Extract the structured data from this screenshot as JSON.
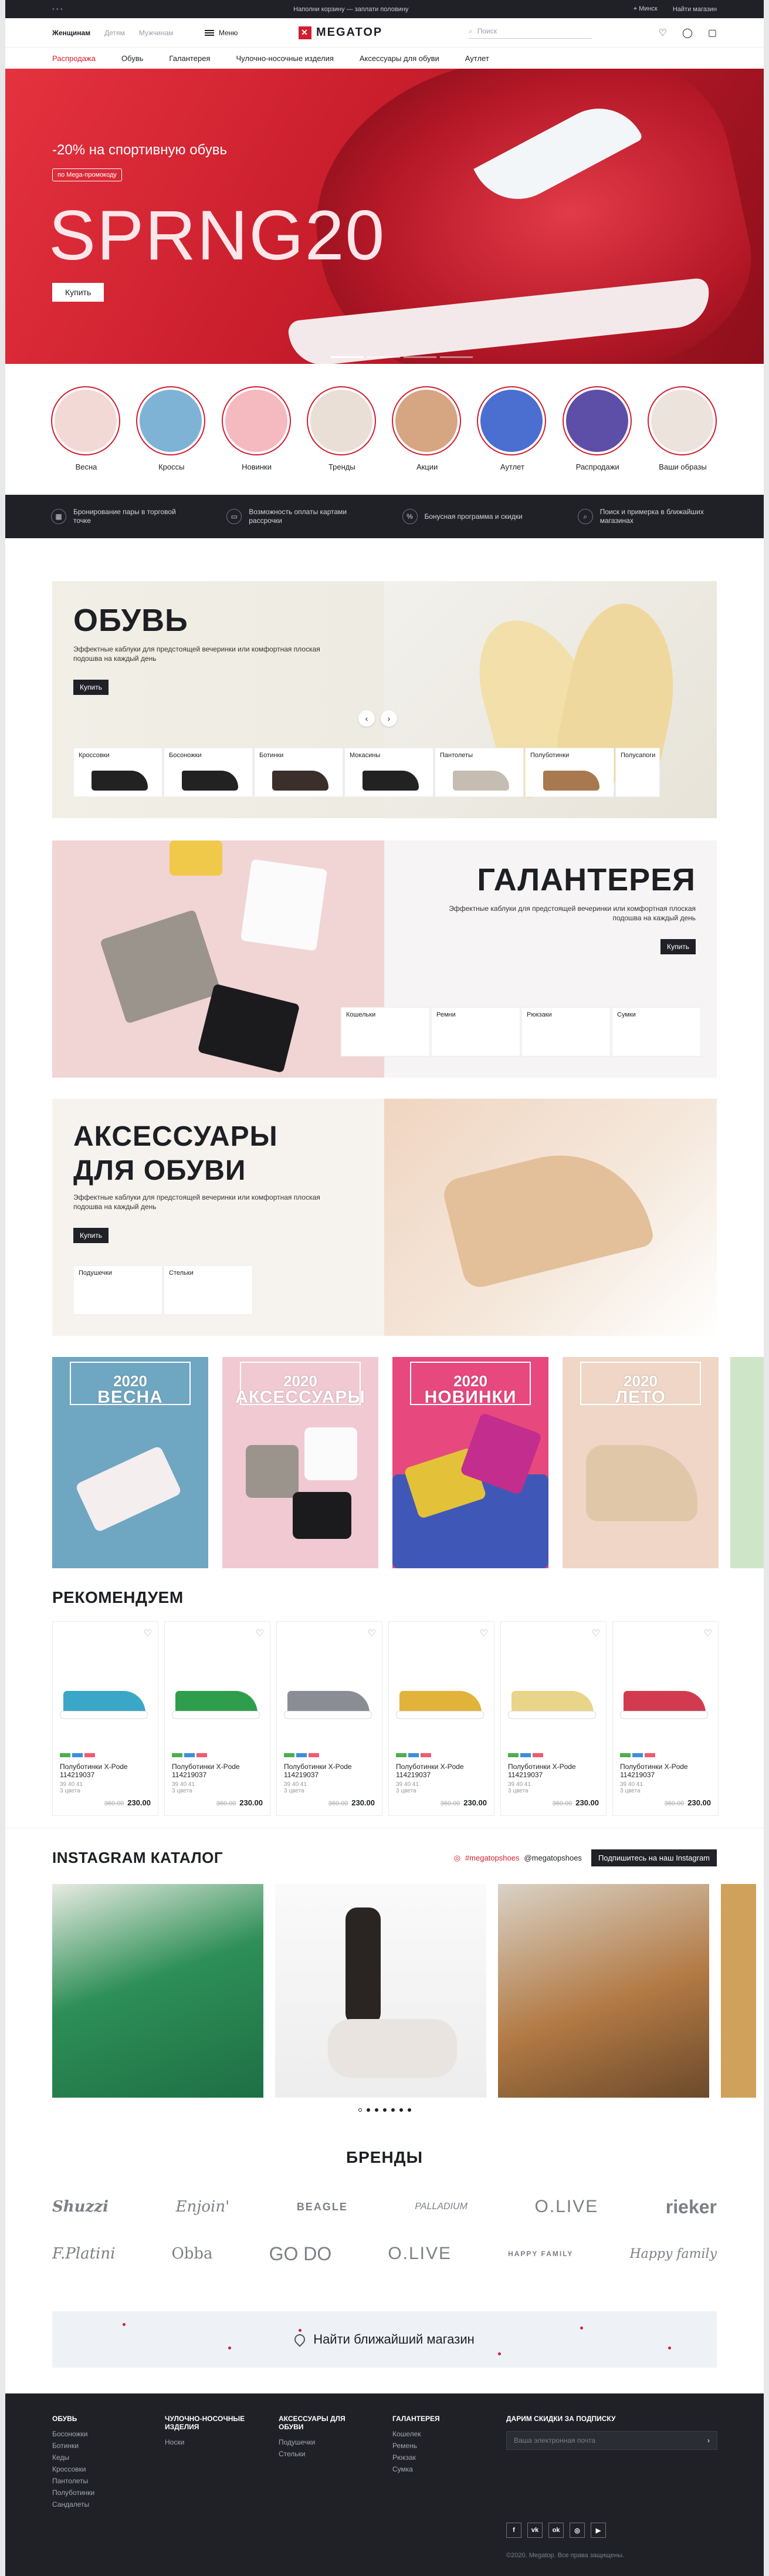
{
  "topbar": {
    "message": "Наполни корзину — заплати половину",
    "city": "Минск",
    "find_store": "Найти магазин"
  },
  "header": {
    "genders": [
      "Женщинам",
      "Детям",
      "Мужчинам"
    ],
    "menu": "Меню",
    "logo": "MEGATOP",
    "search_placeholder": "Поиск"
  },
  "categories": [
    "Распродажа",
    "Обувь",
    "Галантерея",
    "Чулочно-носочные изделия",
    "Аксессуары для обуви",
    "Аутлет"
  ],
  "hero": {
    "promo": "-20% на спортивную обувь",
    "tag": "по Mega-промокоду",
    "big_text": "SPRNG20",
    "button": "Купить"
  },
  "circles": [
    {
      "label": "Весна",
      "color": "#f3d9d6"
    },
    {
      "label": "Кроссы",
      "color": "#7fb3d6"
    },
    {
      "label": "Новинки",
      "color": "#f5b9c0"
    },
    {
      "label": "Тренды",
      "color": "#e9dfd6"
    },
    {
      "label": "Акции",
      "color": "#d6a582"
    },
    {
      "label": "Аутлет",
      "color": "#4a6fd1"
    },
    {
      "label": "Распродажи",
      "color": "#5d4fa8"
    },
    {
      "label": "Ваши образы",
      "color": "#ece3dd"
    }
  ],
  "benefits": [
    {
      "icon": "calendar-icon",
      "text": "Бронирование пары в торговой точке"
    },
    {
      "icon": "card-icon",
      "text": "Возможность оплаты картами рассрочки"
    },
    {
      "icon": "percent-icon",
      "text": "Бонусная программа и скидки"
    },
    {
      "icon": "search-icon",
      "text": "Поиск и примерка в ближайших магазинах"
    }
  ],
  "shoes_block": {
    "title": "ОБУВЬ",
    "text": "Эффектные каблуки для предстоящей вечеринки или комфортная плоская подошва на каждый день",
    "button": "Купить",
    "items": [
      "Кроссовки",
      "Босоножки",
      "Ботинки",
      "Мокасины",
      "Пантолеты",
      "Полуботинки",
      "Полусапоги"
    ]
  },
  "haberdashery_block": {
    "title": "ГАЛАНТЕРЕЯ",
    "text": "Эффектные каблуки для предстоящей вечеринки или комфортная плоская подошва на каждый день",
    "button": "Купить",
    "items": [
      "Кошельки",
      "Ремни",
      "Рюкзаки",
      "Сумки"
    ]
  },
  "accessories_block": {
    "title_line1": "АКСЕССУАРЫ",
    "title_line2": "ДЛЯ ОБУВИ",
    "text": "Эффектные каблуки для предстоящей вечеринки или комфортная плоская подошва на каждый день",
    "button": "Купить",
    "items": [
      "Подушечки",
      "Стельки"
    ]
  },
  "tiles": [
    {
      "year": "2020",
      "title": "ВЕСНА",
      "color": "#6fa6c2"
    },
    {
      "year": "2020",
      "title": "АКСЕССУАРЫ",
      "color": "#f0c9d3"
    },
    {
      "year": "2020",
      "title": "НОВИНКИ",
      "color": "#e7487e"
    },
    {
      "year": "2020",
      "title": "ЛЕТО",
      "color": "#efd6c6"
    }
  ],
  "recommend": {
    "title": "РЕКОМЕНДУЕМ",
    "products": [
      {
        "name": "Полуботинки X-Pode 114219037",
        "sizes": "39 40 41",
        "colors": "3 цвета",
        "old": "360.00",
        "price": "230.00",
        "c": "#3aa6c8"
      },
      {
        "name": "Полуботинки X-Pode 114219037",
        "sizes": "39 40 41",
        "colors": "3 цвета",
        "old": "360.00",
        "price": "230.00",
        "c": "#2f9e4c"
      },
      {
        "name": "Полуботинки X-Pode 114219037",
        "sizes": "39 40 41",
        "colors": "3 цвета",
        "old": "360.00",
        "price": "230.00",
        "c": "#8a8d94"
      },
      {
        "name": "Полуботинки X-Pode 114219037",
        "sizes": "39 40 41",
        "colors": "3 цвета",
        "old": "360.00",
        "price": "230.00",
        "c": "#e2b33a"
      },
      {
        "name": "Полуботинки X-Pode 114219037",
        "sizes": "39 40 41",
        "colors": "3 цвета",
        "old": "360.00",
        "price": "230.00",
        "c": "#e9d58a"
      },
      {
        "name": "Полуботинки X-Pode 114219037",
        "sizes": "39 40 41",
        "colors": "3 цвета",
        "old": "360.00",
        "price": "230.00",
        "c": "#d23b4f"
      }
    ]
  },
  "instagram": {
    "title": "INSTAGRAM КАТАЛОГ",
    "tag1": "#megatopshoes",
    "tag2": "@megatopshoes",
    "subscribe": "Подпишитесь на наш Instagram"
  },
  "brands": {
    "title": "БРЕНДЫ",
    "row1": [
      "Shuzzi",
      "Enjoin'",
      "BEAGLE",
      "PALLADIUM",
      "O.LIVE",
      "rieker"
    ],
    "row2": [
      "F.Platini",
      "Obba",
      "GO DO",
      "O.LIVE",
      "HAPPY FAMILY",
      "Happy family"
    ]
  },
  "find_store": "Найти ближайший магазин",
  "footer": {
    "col1": {
      "title": "ОБУВЬ",
      "items": [
        "Босоножки",
        "Ботинки",
        "Кеды",
        "Кроссовки",
        "Пантолеты",
        "Полуботинки",
        "Сандалеты"
      ]
    },
    "col2": {
      "title": "ЧУЛОЧНО-НОСОЧНЫЕ ИЗДЕЛИЯ",
      "items": [
        "Носки"
      ]
    },
    "col3": {
      "title": "АКСЕССУАРЫ ДЛЯ ОБУВИ",
      "items": [
        "Подушечки",
        "Стельки"
      ]
    },
    "col4": {
      "title": "ГАЛАНТЕРЕЯ",
      "items": [
        "Кошелек",
        "Ремень",
        "Рюкзак",
        "Сумка"
      ]
    },
    "subscribe_title": "ДАРИМ СКИДКИ ЗА ПОДПИСКУ",
    "email_placeholder": "Ваша электронная почта",
    "social": [
      "f",
      "vk",
      "ok",
      "ig",
      "yt"
    ],
    "copyright": "©2020. Megatop. Все права защищены."
  }
}
